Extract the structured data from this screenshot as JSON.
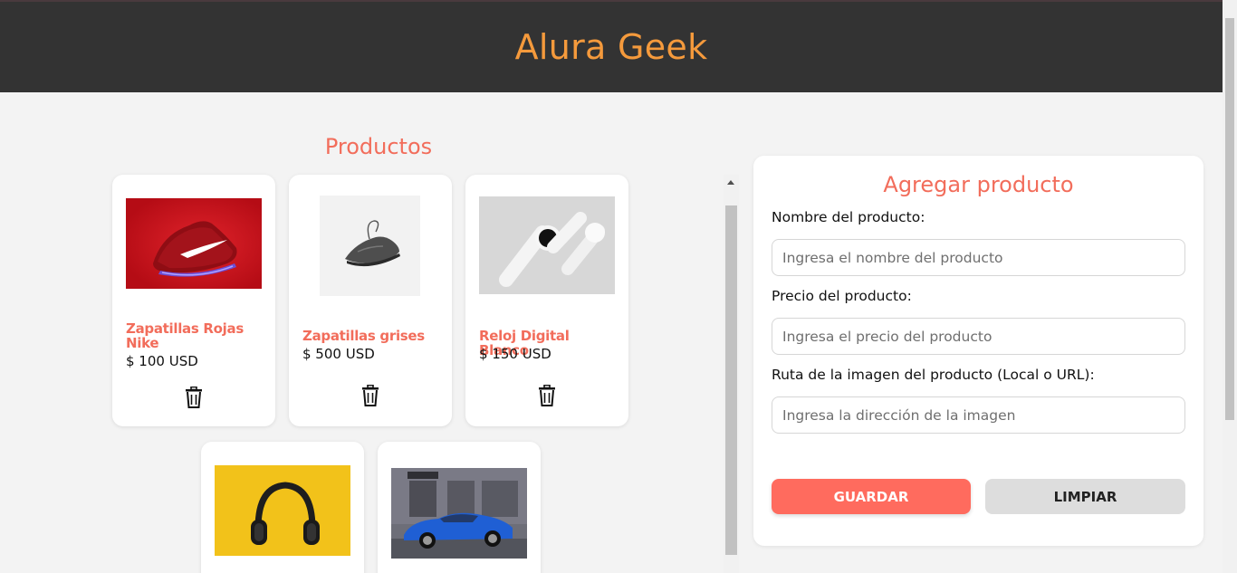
{
  "header": {
    "title": "Alura Geek"
  },
  "products": {
    "title": "Productos",
    "items": [
      {
        "name": "Zapatillas Rojas Nike",
        "price": "$ 100 USD",
        "image": "red-sneaker"
      },
      {
        "name": "Zapatillas grises",
        "price": "$ 500 USD",
        "image": "gray-sneaker"
      },
      {
        "name": "Reloj Digital Blanco",
        "price": "$ 150 USD",
        "image": "white-watch"
      },
      {
        "name": "",
        "price": "",
        "image": "headphones"
      },
      {
        "name": "",
        "price": "",
        "image": "blue-car"
      }
    ]
  },
  "form": {
    "title": "Agregar producto",
    "name_label": "Nombre del producto:",
    "name_placeholder": "Ingresa el nombre del producto",
    "price_label": "Precio del producto:",
    "price_placeholder": "Ingresa el precio del producto",
    "image_label": "Ruta de la imagen del producto (Local o URL):",
    "image_placeholder": "Ingresa la dirección de la imagen",
    "save_label": "GUARDAR",
    "clear_label": "LIMPIAR"
  },
  "colors": {
    "header_bg": "#333333",
    "title_orange": "#f59a3c",
    "accent_coral": "#f26d5b",
    "save_button": "#ff6b5e",
    "clear_button": "#dddddd"
  },
  "icons": {
    "delete": "trash-icon"
  }
}
